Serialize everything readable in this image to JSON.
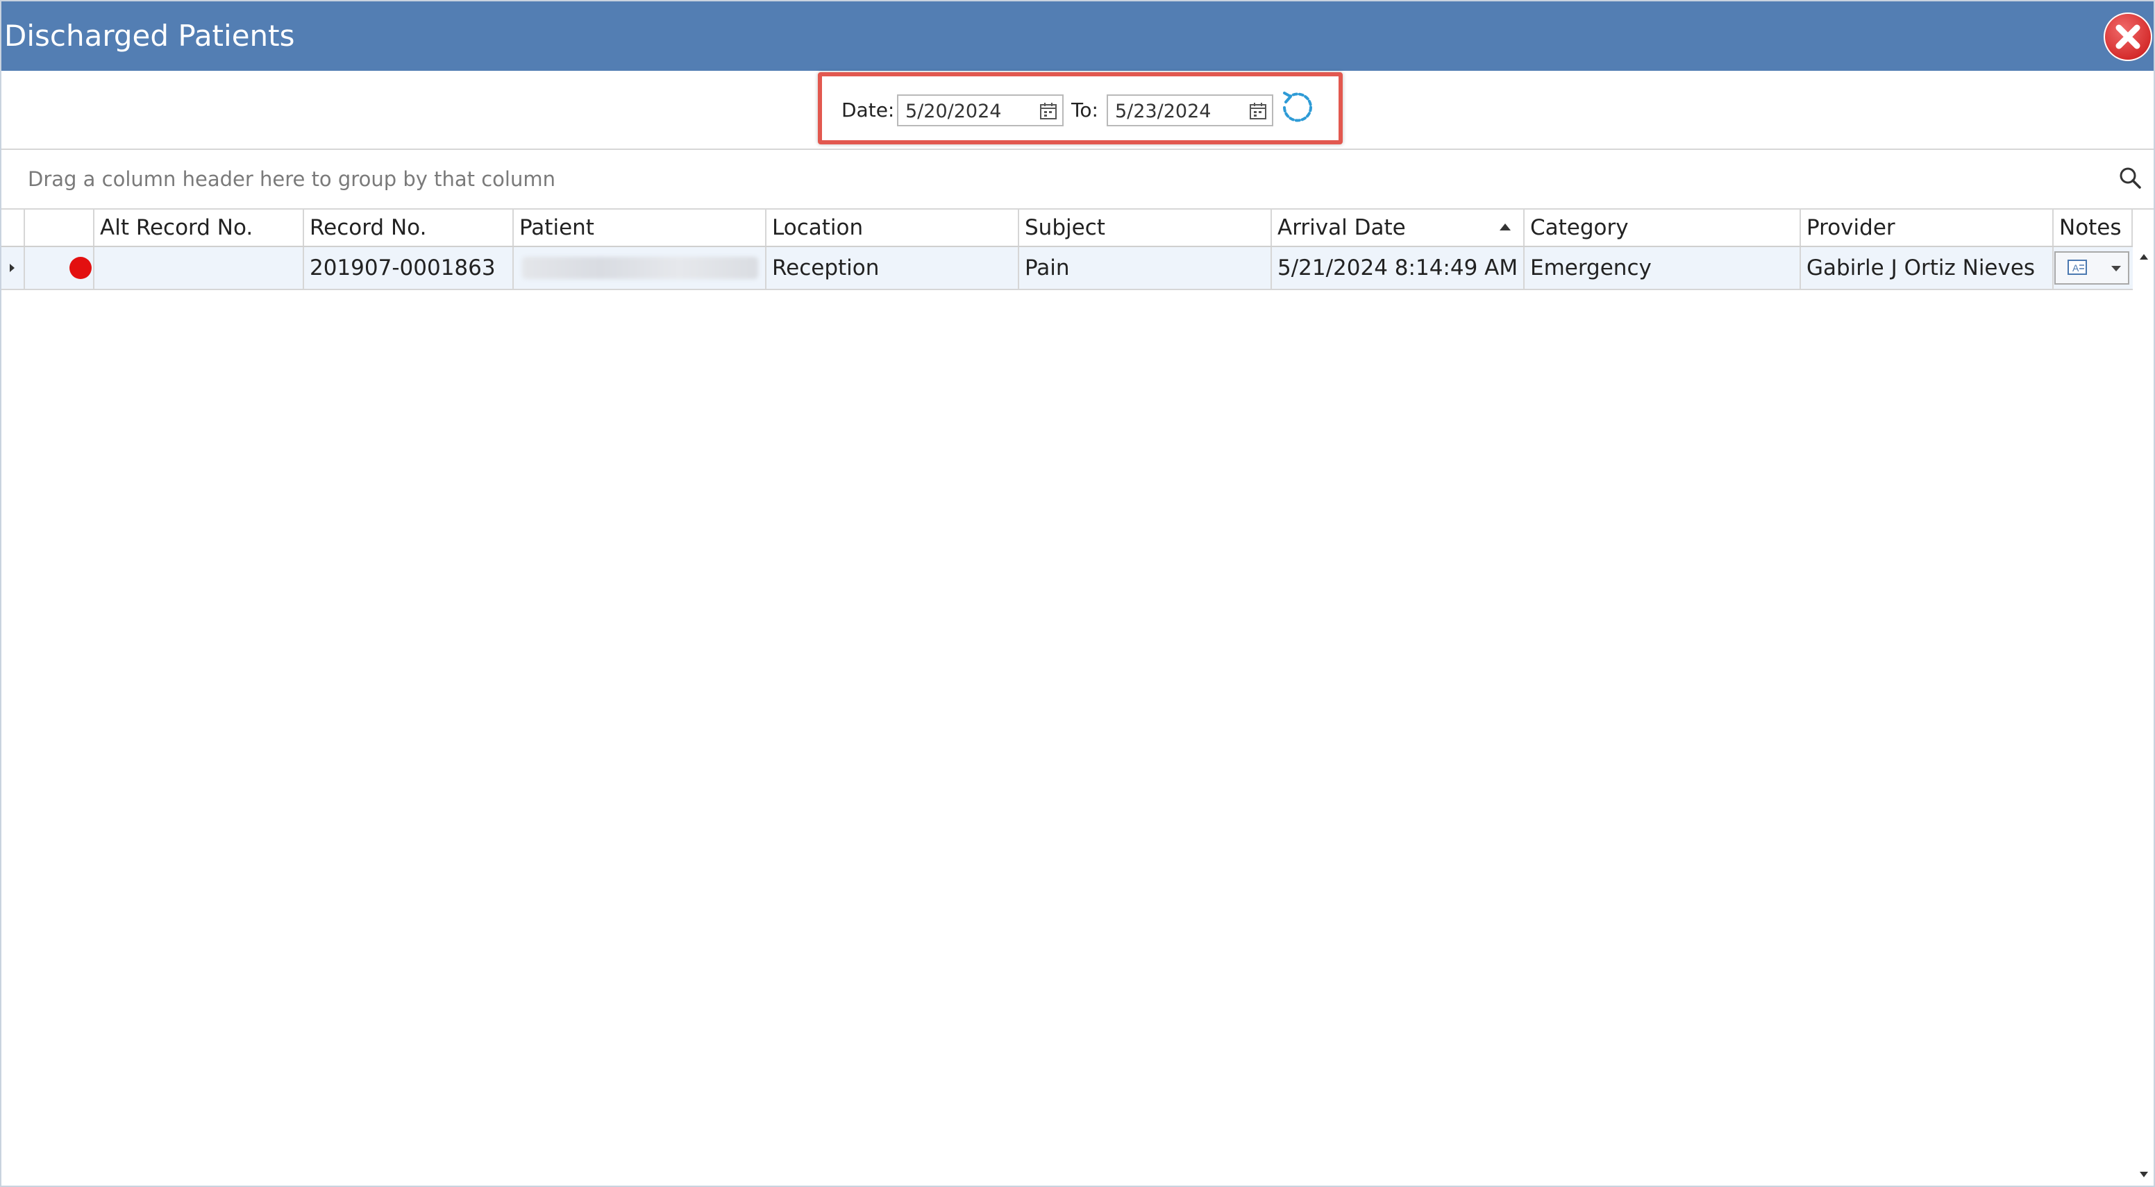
{
  "window": {
    "title": "Discharged Patients",
    "titlebar_color": "#537eb3",
    "close_icon": "close-icon"
  },
  "filter": {
    "date_label": "Date:",
    "from_value": "5/20/2024",
    "to_label": "To:",
    "to_value": "5/23/2024",
    "refresh_icon": "refresh-icon",
    "calendar_icon": "calendar-icon",
    "highlight_color": "#e2584f"
  },
  "group_panel": {
    "hint": "Drag a column header here to group by that column",
    "search_icon": "search-icon"
  },
  "grid": {
    "columns": [
      {
        "key": "status",
        "label": ""
      },
      {
        "key": "alt_record_no",
        "label": "Alt Record No."
      },
      {
        "key": "record_no",
        "label": "Record No."
      },
      {
        "key": "patient",
        "label": "Patient"
      },
      {
        "key": "location",
        "label": "Location"
      },
      {
        "key": "subject",
        "label": "Subject"
      },
      {
        "key": "arrival_date",
        "label": "Arrival Date",
        "sorted": "ascending"
      },
      {
        "key": "category",
        "label": "Category"
      },
      {
        "key": "provider",
        "label": "Provider"
      },
      {
        "key": "notes",
        "label": "Notes"
      }
    ],
    "rows": [
      {
        "status_color": "#e31010",
        "alt_record_no": "",
        "record_no": "201907-0001863",
        "patient": "",
        "location": "Reception",
        "subject": "Pain",
        "arrival_date": "5/21/2024 8:14:49 AM",
        "category": "Emergency",
        "provider": "Gabirle J Ortiz Nieves",
        "notes_icon": "document-icon"
      }
    ]
  }
}
